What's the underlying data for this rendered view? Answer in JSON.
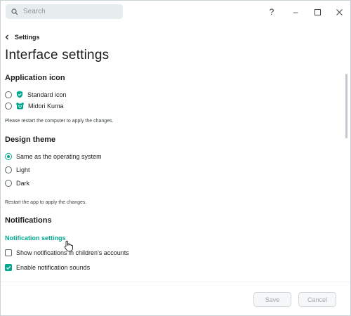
{
  "search": {
    "placeholder": "Search"
  },
  "window_controls": {
    "help": "?",
    "minimize": "–",
    "maximize": "☐",
    "close": "✕"
  },
  "nav": {
    "back_label": "Settings"
  },
  "page": {
    "title": "Interface settings"
  },
  "application_icon": {
    "title": "Application icon",
    "options": [
      {
        "label": "Standard icon",
        "icon": "shield-icon",
        "checked": false
      },
      {
        "label": "Midori Kuma",
        "icon": "bear-icon",
        "checked": false
      }
    ],
    "note": "Please restart the computer to apply the changes."
  },
  "design_theme": {
    "title": "Design theme",
    "options": [
      {
        "label": "Same as the operating system",
        "checked": true
      },
      {
        "label": "Light",
        "checked": false
      },
      {
        "label": "Dark",
        "checked": false
      }
    ],
    "note": "Restart the app to apply the changes."
  },
  "notifications": {
    "title": "Notifications",
    "settings_link": "Notification settings",
    "options": [
      {
        "label": "Show notifications in children's accounts",
        "checked": false
      },
      {
        "label": "Enable notification sounds",
        "checked": true
      }
    ]
  },
  "footer": {
    "save_label": "Save",
    "cancel_label": "Cancel"
  },
  "colors": {
    "accent": "#00a88e",
    "text": "#1d1d1b",
    "search_bg": "#e7ecee"
  }
}
